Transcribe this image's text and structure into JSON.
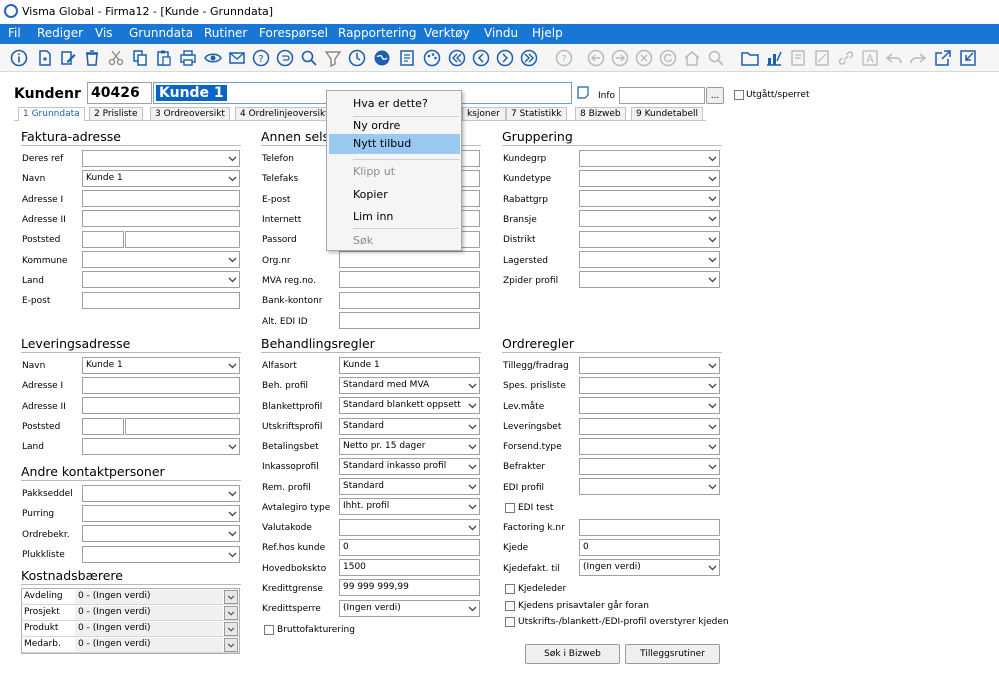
{
  "window": {
    "title": "Visma Global - Firma12 - [Kunde - Grunndata]"
  },
  "menu": [
    "Fil",
    "Rediger",
    "Vis",
    "Grunndata",
    "Rutiner",
    "Forespørsel",
    "Rapportering",
    "Verktøy",
    "Vindu",
    "Hjelp"
  ],
  "header": {
    "kundenr_label": "Kundenr",
    "kundenr": "40426",
    "name": "Kunde 1",
    "info_label": "Info",
    "info_value": "",
    "info_button": "...",
    "utgatt_label": "Utgått/sperret"
  },
  "tabs": [
    "1 Grunndata",
    "2 Prisliste",
    "3 Ordreoversikt",
    "4 Ordrelinjeoversikt",
    "... ",
    "6 Transaksjoner",
    "7 Statistikk",
    "8 Bizweb",
    "9 Kundetabell"
  ],
  "tabs_visible": {
    "t6": "ksjoner"
  },
  "faktura": {
    "title": "Faktura-adresse",
    "deres_ref": "Deres ref",
    "navn": "Navn",
    "navn_value": "Kunde 1",
    "adresse1": "Adresse I",
    "adresse2": "Adresse II",
    "poststed": "Poststed",
    "kommune": "Kommune",
    "land": "Land",
    "epost": "E-post"
  },
  "levering": {
    "title": "Leveringsadresse",
    "navn": "Navn",
    "navn_value": "Kunde 1",
    "adresse1": "Adresse I",
    "adresse2": "Adresse II",
    "poststed": "Poststed",
    "land": "Land"
  },
  "kontakt": {
    "title": "Andre kontaktpersoner",
    "pakkseddel": "Pakkseddel",
    "purring": "Purring",
    "ordrebekr": "Ordrebekr.",
    "plukkliste": "Plukkliste"
  },
  "kost": {
    "title": "Kostnadsbærere",
    "rows": [
      {
        "k": "Avdeling",
        "v": "0 - (Ingen verdi)"
      },
      {
        "k": "Prosjekt",
        "v": "0 - (Ingen verdi)"
      },
      {
        "k": "Produkt",
        "v": "0 - (Ingen verdi)"
      },
      {
        "k": "Medarb.",
        "v": "0 - (Ingen verdi)"
      }
    ]
  },
  "annen": {
    "title": "Annen sels",
    "telefon": "Telefon",
    "telefaks": "Telefaks",
    "epost": "E-post",
    "internett": "Internett",
    "passord": "Passord",
    "orgnr": "Org.nr",
    "mva": "MVA reg.no.",
    "bank": "Bank-kontonr",
    "edi": "Alt. EDI ID"
  },
  "behandling": {
    "title": "Behandlingsregler",
    "alfasort": "Alfasort",
    "alfasort_value": "Kunde 1",
    "beh_profil": "Beh. profil",
    "beh_profil_value": "Standard med MVA",
    "blankettprofil": "Blankettprofil",
    "blankettprofil_value": "Standard blankett oppsett",
    "utskriftsprofil": "Utskriftsprofil",
    "utskriftsprofil_value": "Standard",
    "betalingsbet": "Betalingsbet",
    "betalingsbet_value": "Netto pr. 15 dager",
    "inkassoprofil": "Inkassoprofil",
    "inkassoprofil_value": "Standard inkasso profil",
    "rem_profil": "Rem. profil",
    "rem_profil_value": "Standard",
    "avtalegiro": "Avtalegiro type",
    "avtalegiro_value": "Ihht. profil",
    "valutakode": "Valutakode",
    "refhos": "Ref.hos kunde",
    "refhos_value": "0",
    "hovedbok": "Hovedbokskto",
    "hovedbok_value": "1500",
    "kredittgrense": "Kredittgrense",
    "kredittgrense_value": "99 999 999,99",
    "kredittsperre": "Kredittsperre",
    "kredittsperre_value": "(Ingen verdi)",
    "brutto": "Bruttofakturering"
  },
  "gruppering": {
    "title": "Gruppering",
    "kundegrp": "Kundegrp",
    "kundetype": "Kundetype",
    "rabattgrp": "Rabattgrp",
    "bransje": "Bransje",
    "distrikt": "Distrikt",
    "lagersted": "Lagersted",
    "zpider": "Zpider profil"
  },
  "ordreregler": {
    "title": "Ordreregler",
    "tillegg": "Tillegg/fradrag",
    "spes": "Spes. prisliste",
    "levmate": "Lev.måte",
    "leveringsbet": "Leveringsbet",
    "forsend": "Forsend.type",
    "befrakter": "Befrakter",
    "ediprofil": "EDI profil",
    "editest": "EDI test",
    "factoring": "Factoring k.nr",
    "kjede": "Kjede",
    "kjede_value": "0",
    "kjedefakt": "Kjedefakt. til",
    "kjedefakt_value": "(Ingen verdi)",
    "kjedeleder": "Kjedeleder",
    "kjedens": "Kjedens prisavtaler går foran",
    "utskrifts": "Utskrifts-/blankett-/EDI-profil overstyrer kjeden"
  },
  "buttons": {
    "bizweb": "Søk i Bizweb",
    "tillegg": "Tilleggsrutiner"
  },
  "context_menu": [
    "Hva er dette?",
    "Ny ordre",
    "Nytt tilbud",
    "Klipp ut",
    "Kopier",
    "Lim inn",
    "Søk"
  ],
  "colors": {
    "menubar": "#1877d4",
    "highlight": "#99c9f2",
    "selected_text": "#0a64c8",
    "icon_blue": "#1c5fb0"
  }
}
